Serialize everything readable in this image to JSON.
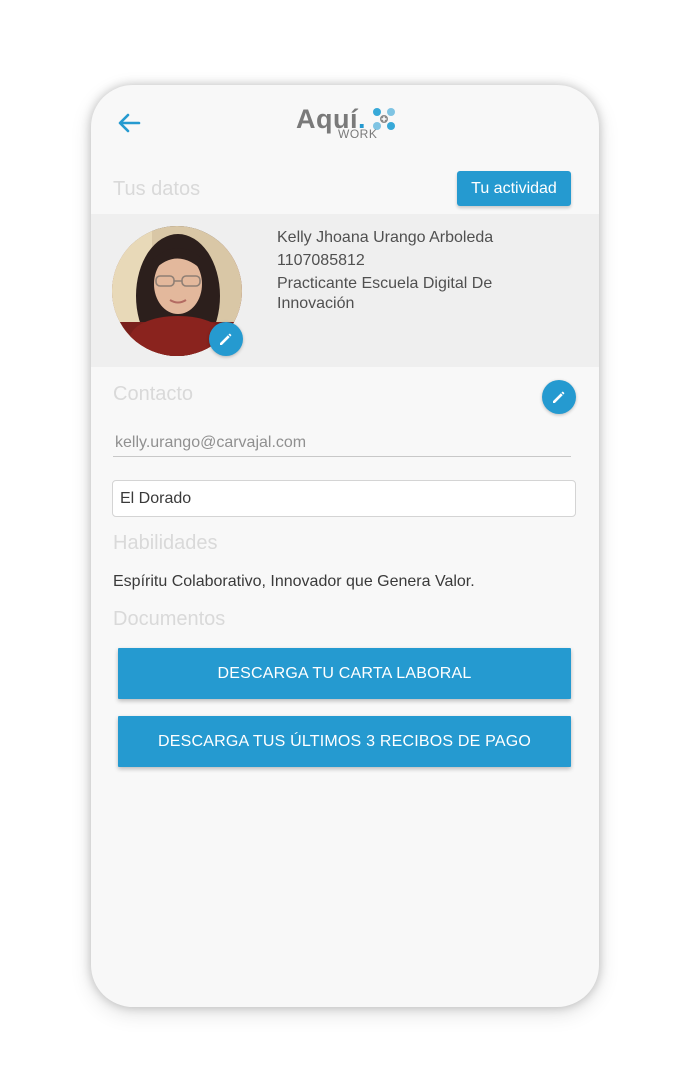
{
  "header": {
    "logo_text": "Aquí",
    "logo_dot": ".",
    "logo_sub": "WORK",
    "back_icon": "arrow-left-icon"
  },
  "tus_datos": {
    "title": "Tus datos",
    "activity_button": "Tu actividad"
  },
  "profile": {
    "name": "Kelly Jhoana Urango Arboleda",
    "id_number": "1107085812",
    "role": "Practicante Escuela Digital De Innovación"
  },
  "contact": {
    "title": "Contacto",
    "email": "kelly.urango@carvajal.com",
    "location": "El Dorado"
  },
  "skills": {
    "title": "Habilidades",
    "text": "Espíritu Colaborativo, Innovador que Genera Valor."
  },
  "documents": {
    "title": "Documentos",
    "btn_letter": "DESCARGA TU CARTA LABORAL",
    "btn_receipts": "DESCARGA TUS ÚLTIMOS 3 RECIBOS DE PAGO"
  },
  "colors": {
    "accent": "#259ad0",
    "muted_title": "#d9d9d9",
    "text": "#505050"
  }
}
